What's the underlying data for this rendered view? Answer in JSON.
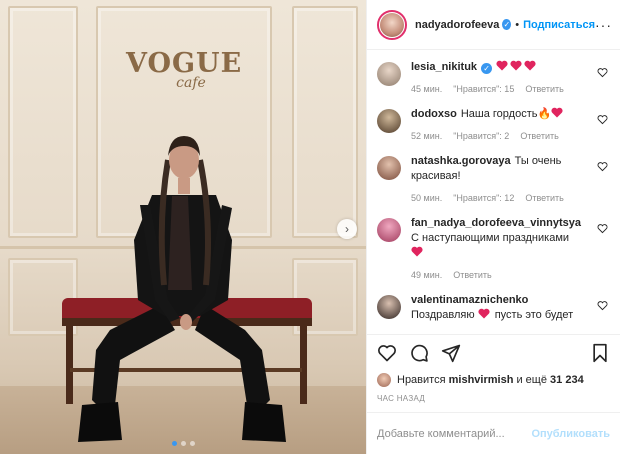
{
  "header": {
    "username": "nadyadorofeeva",
    "separator": "•",
    "follow_label": "Подписаться",
    "more_label": "···"
  },
  "photo": {
    "sign_line1": "VOGUE",
    "sign_line2": "cafe",
    "next_label": "›",
    "page_dots": 3,
    "active_dot": 1
  },
  "comments": [
    {
      "user": "lesia_nikituk",
      "verified": true,
      "text": "",
      "hearts": 3,
      "time": "45 мин.",
      "likes": "\"Нравится\": 15",
      "reply": "Ответить"
    },
    {
      "user": "dodoxso",
      "verified": false,
      "text": "Наша гордость🔥",
      "hearts": 1,
      "time": "52 мин.",
      "likes": "\"Нравится\": 2",
      "reply": "Ответить"
    },
    {
      "user": "natashka.gorovaya",
      "verified": false,
      "text": "Ты очень красивая!",
      "hearts": 0,
      "time": "50 мин.",
      "likes": "\"Нравится\": 12",
      "reply": "Ответить"
    },
    {
      "user": "fan_nadya_dorofeeva_vinnytsya",
      "verified": false,
      "text": "С наступающими праздниками",
      "hearts": 1,
      "time": "49 мин.",
      "likes": "",
      "reply": "Ответить"
    },
    {
      "user": "valentinamaznichenko",
      "verified": false,
      "text": "Поздравляю",
      "text_after": "пусть это будет",
      "hearts": 1,
      "time": "",
      "likes": "",
      "reply": ""
    }
  ],
  "likes": {
    "prefix": "Нравится",
    "user": "mishvirmish",
    "middle": "и ещё",
    "count": "31 234"
  },
  "time_ago": "ЧАС НАЗАД",
  "add_comment": {
    "placeholder": "Добавьте комментарий...",
    "publish_label": "Опубликовать"
  },
  "colors": {
    "accent": "#0095f6",
    "publish_disabled": "#b2dffc",
    "heart_red": "#ed4956",
    "muted": "#8e8e8e"
  },
  "icons": [
    "heart-outline-icon",
    "comment-icon",
    "share-icon",
    "bookmark-icon",
    "verified-badge-icon",
    "chevron-right-icon"
  ]
}
